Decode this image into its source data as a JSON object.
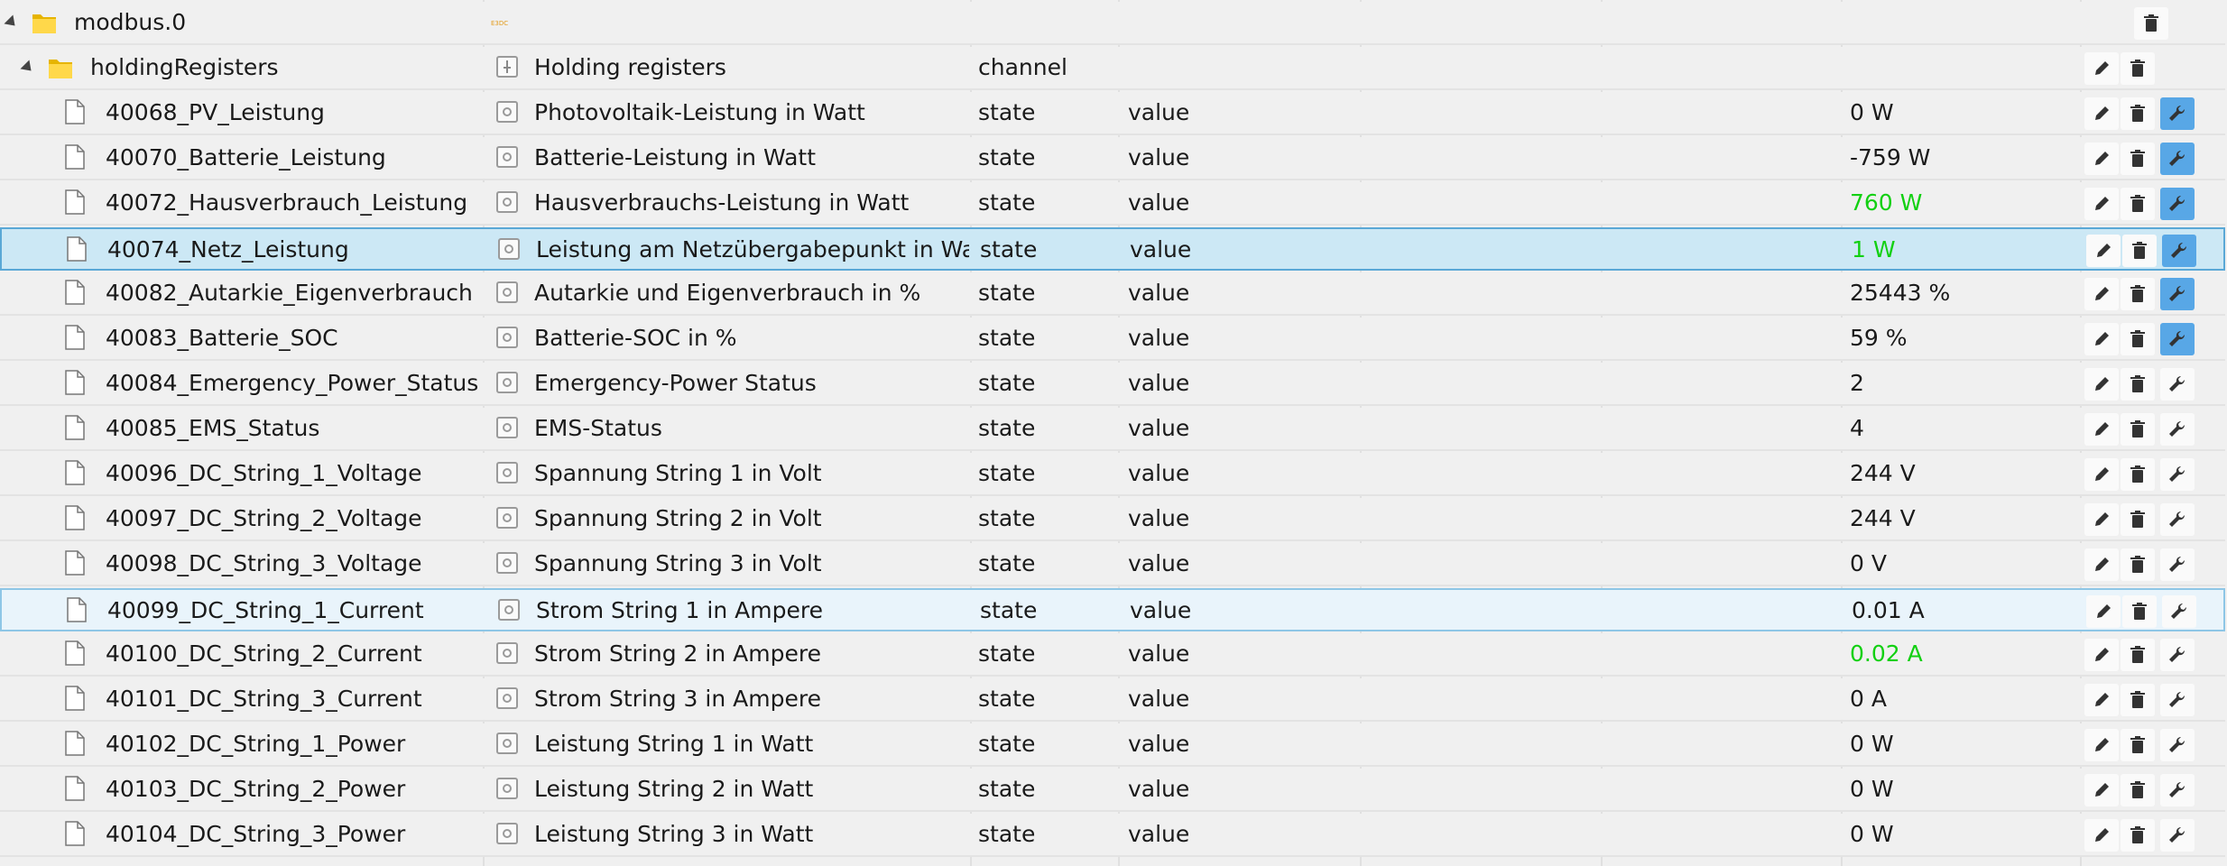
{
  "root": {
    "name": "modbus.0",
    "logo_text": "E3DC"
  },
  "channel": {
    "name": "holdingRegisters",
    "title": "Holding registers",
    "type": "channel"
  },
  "states": [
    {
      "name": "40068_PV_Leistung",
      "title": "Photovoltaik-Leistung in Watt",
      "type": "state",
      "role": "value",
      "value": "0 W",
      "color": "",
      "wrench_active": true,
      "highlight": ""
    },
    {
      "name": "40070_Batterie_Leistung",
      "title": "Batterie-Leistung in Watt",
      "type": "state",
      "role": "value",
      "value": "-759 W",
      "color": "",
      "wrench_active": true,
      "highlight": ""
    },
    {
      "name": "40072_Hausverbrauch_Leistung",
      "title": "Hausverbrauchs-Leistung in Watt",
      "type": "state",
      "role": "value",
      "value": "760 W",
      "color": "#12d012",
      "wrench_active": true,
      "highlight": ""
    },
    {
      "name": "40074_Netz_Leistung",
      "title": "Leistung am Netzübergabepunkt in Watt",
      "type": "state",
      "role": "value",
      "value": "1 W",
      "color": "#12d012",
      "wrench_active": true,
      "highlight": "selected"
    },
    {
      "name": "40082_Autarkie_Eigenverbrauch",
      "title": "Autarkie und Eigenverbrauch in %",
      "type": "state",
      "role": "value",
      "value": "25443 %",
      "color": "",
      "wrench_active": true,
      "highlight": ""
    },
    {
      "name": "40083_Batterie_SOC",
      "title": "Batterie-SOC in %",
      "type": "state",
      "role": "value",
      "value": "59 %",
      "color": "",
      "wrench_active": true,
      "highlight": ""
    },
    {
      "name": "40084_Emergency_Power_Status",
      "title": "Emergency-Power Status",
      "type": "state",
      "role": "value",
      "value": "2",
      "color": "",
      "wrench_active": false,
      "highlight": ""
    },
    {
      "name": "40085_EMS_Status",
      "title": "EMS-Status",
      "type": "state",
      "role": "value",
      "value": "4",
      "color": "",
      "wrench_active": false,
      "highlight": ""
    },
    {
      "name": "40096_DC_String_1_Voltage",
      "title": "Spannung String 1 in Volt",
      "type": "state",
      "role": "value",
      "value": "244 V",
      "color": "",
      "wrench_active": false,
      "highlight": ""
    },
    {
      "name": "40097_DC_String_2_Voltage",
      "title": "Spannung String 2 in Volt",
      "type": "state",
      "role": "value",
      "value": "244 V",
      "color": "",
      "wrench_active": false,
      "highlight": ""
    },
    {
      "name": "40098_DC_String_3_Voltage",
      "title": "Spannung String 3 in Volt",
      "type": "state",
      "role": "value",
      "value": "0 V",
      "color": "",
      "wrench_active": false,
      "highlight": ""
    },
    {
      "name": "40099_DC_String_1_Current",
      "title": "Strom String 1 in Ampere",
      "type": "state",
      "role": "value",
      "value": "0.01 A",
      "color": "",
      "wrench_active": false,
      "highlight": "hover"
    },
    {
      "name": "40100_DC_String_2_Current",
      "title": "Strom String 2 in Ampere",
      "type": "state",
      "role": "value",
      "value": "0.02 A",
      "color": "#12d012",
      "wrench_active": false,
      "highlight": ""
    },
    {
      "name": "40101_DC_String_3_Current",
      "title": "Strom String 3 in Ampere",
      "type": "state",
      "role": "value",
      "value": "0 A",
      "color": "",
      "wrench_active": false,
      "highlight": ""
    },
    {
      "name": "40102_DC_String_1_Power",
      "title": "Leistung String 1 in Watt",
      "type": "state",
      "role": "value",
      "value": "0 W",
      "color": "",
      "wrench_active": false,
      "highlight": ""
    },
    {
      "name": "40103_DC_String_2_Power",
      "title": "Leistung String 2 in Watt",
      "type": "state",
      "role": "value",
      "value": "0 W",
      "color": "",
      "wrench_active": false,
      "highlight": ""
    },
    {
      "name": "40104_DC_String_3_Power",
      "title": "Leistung String 3 in Watt",
      "type": "state",
      "role": "value",
      "value": "0 W",
      "color": "",
      "wrench_active": false,
      "highlight": ""
    }
  ],
  "colors": {
    "accent": "#58a7e6",
    "selected_row": "#cce8f5",
    "value_changed": "#12d012"
  }
}
